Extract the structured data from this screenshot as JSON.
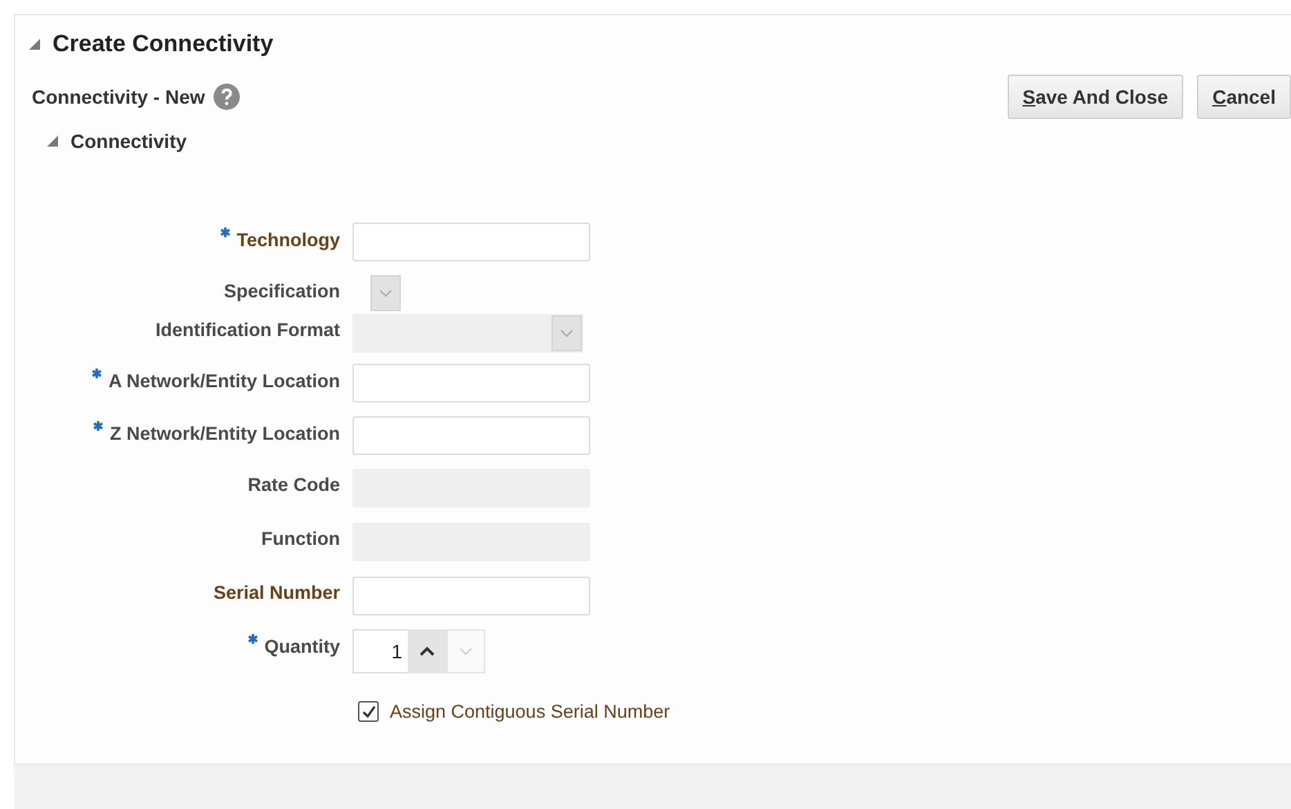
{
  "page": {
    "title": "Create Connectivity",
    "expanded": true
  },
  "subheader": {
    "title": "Connectivity - New"
  },
  "buttons": [
    {
      "label": "Save And Close"
    },
    {
      "label": "Cancel"
    }
  ],
  "section": {
    "title": "Connectivity",
    "expanded": true
  },
  "fields": [
    {
      "label": "Technology",
      "required": true,
      "emphasis": true,
      "kind": "text"
    },
    {
      "label": "Specification",
      "required": false,
      "emphasis": false,
      "kind": "small-select"
    },
    {
      "label": "Identification Format",
      "required": false,
      "emphasis": false,
      "kind": "select"
    },
    {
      "label": "A Network/Entity Location",
      "required": true,
      "emphasis": false,
      "kind": "text"
    },
    {
      "label": "Z Network/Entity Location",
      "required": true,
      "emphasis": false,
      "kind": "text"
    },
    {
      "label": "Rate Code",
      "required": false,
      "emphasis": false,
      "kind": "readonly"
    },
    {
      "label": "Function",
      "required": false,
      "emphasis": false,
      "kind": "readonly"
    },
    {
      "label": "Serial Number",
      "required": false,
      "emphasis": true,
      "kind": "text"
    },
    {
      "label": "Quantity",
      "required": true,
      "emphasis": false,
      "kind": "number",
      "value": "1"
    }
  ],
  "checkbox": {
    "label": "Assign Contiguous Serial Number",
    "checked": true
  }
}
